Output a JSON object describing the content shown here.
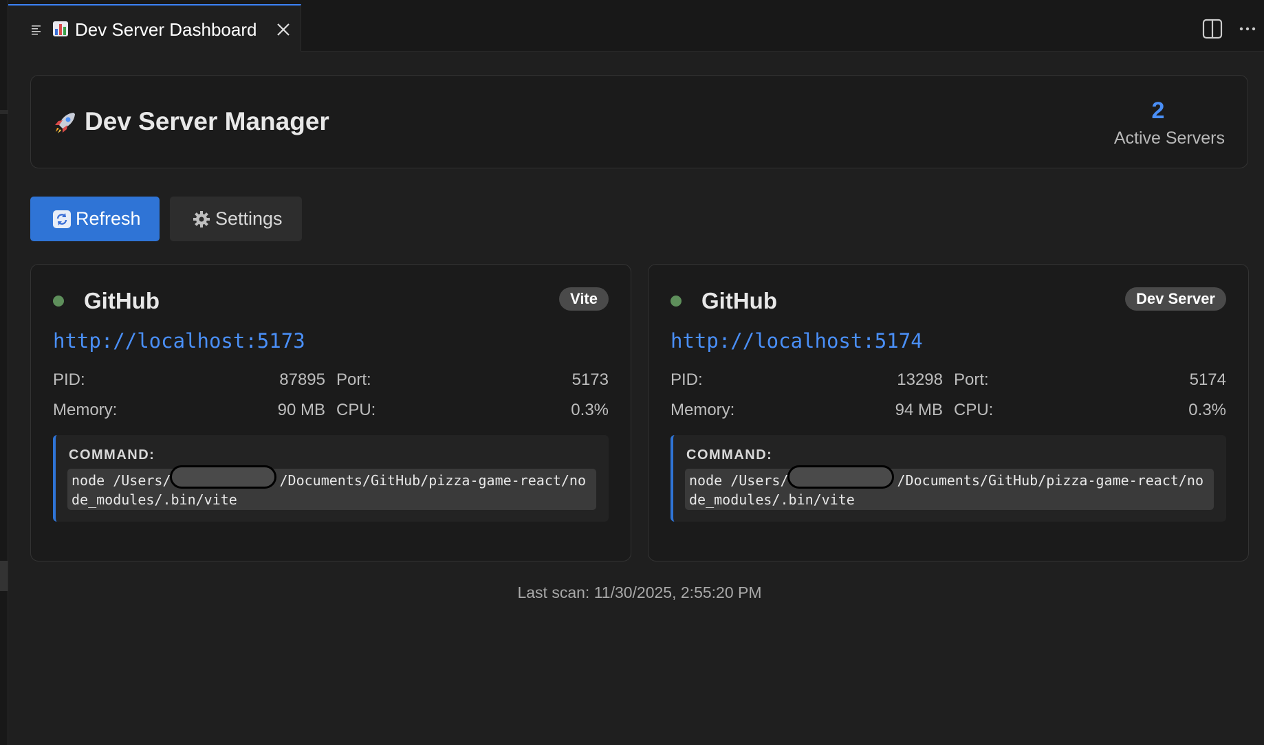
{
  "tab": {
    "title": "Dev Server Dashboard"
  },
  "header": {
    "title": "Dev Server Manager",
    "active_count": "2",
    "active_label": "Active Servers"
  },
  "toolbar": {
    "refresh_label": "Refresh",
    "settings_label": "Settings"
  },
  "servers": [
    {
      "name": "GitHub",
      "type": "Vite",
      "url": "http://localhost:5173",
      "pid_label": "PID:",
      "pid": "87895",
      "port_label": "Port:",
      "port": "5173",
      "memory_label": "Memory:",
      "memory": "90 MB",
      "cpu_label": "CPU:",
      "cpu": "0.3%",
      "command_label": "COMMAND:",
      "command_prefix": "node /Users/",
      "command_suffix": "/Documents/GitHub/pizza-game-react/node_modules/.bin/vite",
      "status_color": "#5e8f5b"
    },
    {
      "name": "GitHub",
      "type": "Dev Server",
      "url": "http://localhost:5174",
      "pid_label": "PID:",
      "pid": "13298",
      "port_label": "Port:",
      "port": "5174",
      "memory_label": "Memory:",
      "memory": "94 MB",
      "cpu_label": "CPU:",
      "cpu": "0.3%",
      "command_label": "COMMAND:",
      "command_prefix": "node /Users/",
      "command_suffix": "/Documents/GitHub/pizza-game-react/node_modules/.bin/vite",
      "status_color": "#5e8f5b"
    }
  ],
  "footer": {
    "last_scan": "Last scan: 11/30/2025, 2:55:20 PM"
  },
  "colors": {
    "accent": "#2f74d6",
    "link": "#4a8ff7",
    "background": "#1f1f1f"
  }
}
